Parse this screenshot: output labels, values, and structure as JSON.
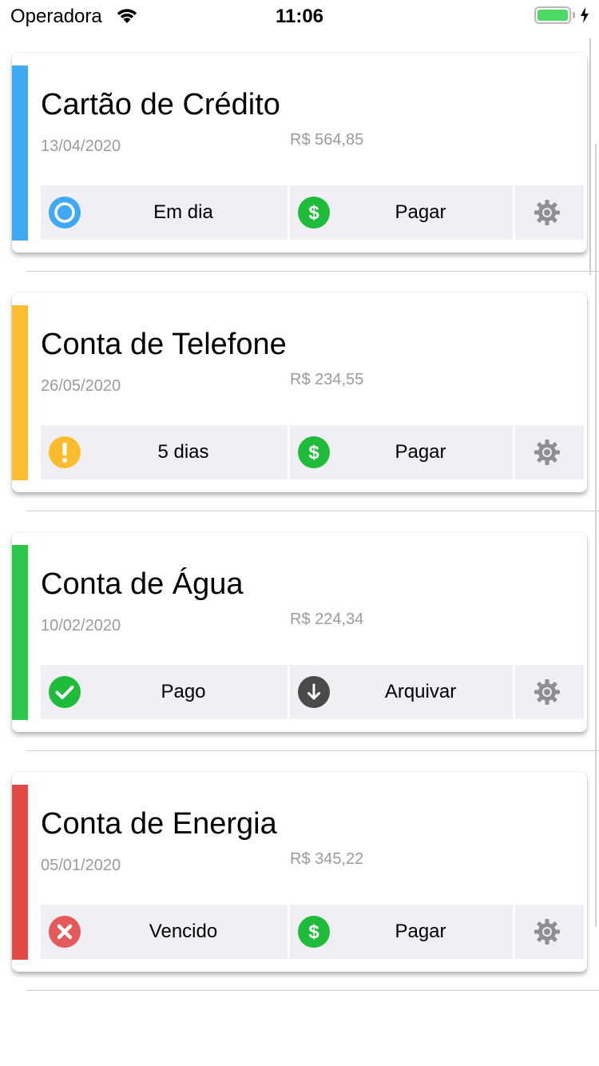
{
  "status_bar": {
    "carrier": "Operadora",
    "time": "11:06",
    "battery_color": "#4cd964"
  },
  "bills": [
    {
      "title": "Cartão de Crédito",
      "date": "13/04/2020",
      "amount": "R$ 564,85",
      "stripe_color": "#3fa9f5",
      "status_label": "Em dia",
      "status_icon": "circle-outline-icon",
      "action_label": "Pagar",
      "action_icon": "dollar-icon"
    },
    {
      "title": "Conta de Telefone",
      "date": "26/05/2020",
      "amount": "R$ 234,55",
      "stripe_color": "#fbbd2e",
      "status_label": "5 dias",
      "status_icon": "warning-icon",
      "action_label": "Pagar",
      "action_icon": "dollar-icon"
    },
    {
      "title": "Conta de Água",
      "date": "10/02/2020",
      "amount": "R$ 224,34",
      "stripe_color": "#2ac84a",
      "status_label": "Pago",
      "status_icon": "check-icon",
      "action_label": "Arquivar",
      "action_icon": "archive-down-icon"
    },
    {
      "title": "Conta de Energia",
      "date": "05/01/2020",
      "amount": "R$ 345,22",
      "stripe_color": "#e24a45",
      "status_label": "Vencido",
      "status_icon": "close-icon",
      "action_label": "Pagar",
      "action_icon": "dollar-icon"
    }
  ]
}
